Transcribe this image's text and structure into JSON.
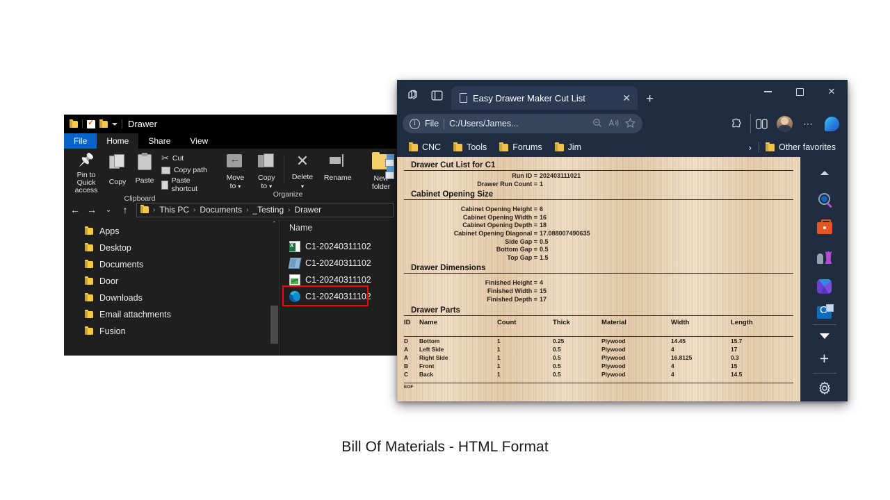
{
  "caption": "Bill Of Materials - HTML Format",
  "explorer": {
    "title": "Drawer",
    "quick_access_icons": [
      "folder-icon",
      "properties-icon",
      "new-folder-icon",
      "customize-chevron-icon"
    ],
    "tabs": [
      {
        "label": "File",
        "active": false,
        "style": "file"
      },
      {
        "label": "Home",
        "active": true,
        "style": "normal"
      },
      {
        "label": "Share",
        "active": false,
        "style": "normal"
      },
      {
        "label": "View",
        "active": false,
        "style": "normal"
      }
    ],
    "ribbon": {
      "clipboard": {
        "group_label": "Clipboard",
        "big_buttons": [
          {
            "label": "Pin to Quick\naccess",
            "line1": "Pin to Quick",
            "line2": "access",
            "icon": "pin-icon"
          },
          {
            "label": "Copy",
            "line1": "Copy",
            "line2": "",
            "icon": "copy-icon"
          },
          {
            "label": "Paste",
            "line1": "Paste",
            "line2": "",
            "icon": "paste-icon"
          }
        ],
        "small_buttons": [
          {
            "label": "Cut",
            "icon": "scissors-icon"
          },
          {
            "label": "Copy path",
            "icon": "copy-path-icon"
          },
          {
            "label": "Paste shortcut",
            "icon": "paste-shortcut-icon"
          }
        ]
      },
      "organize": {
        "group_label": "Organize",
        "big_buttons": [
          {
            "line1": "Move",
            "line2": "to",
            "icon": "move-to-icon",
            "dropdown": true
          },
          {
            "line1": "Copy",
            "line2": "to",
            "icon": "copy-to-icon",
            "dropdown": true
          },
          {
            "line1": "Delete",
            "line2": "",
            "icon": "delete-icon",
            "dropdown": true
          },
          {
            "line1": "Rename",
            "line2": "",
            "icon": "rename-icon",
            "dropdown": false
          }
        ]
      },
      "new": {
        "big_buttons": [
          {
            "line1": "New",
            "line2": "folder",
            "icon": "new-folder-icon"
          }
        ]
      }
    },
    "navigation": {
      "back_icon": "arrow-left-icon",
      "forward_icon": "arrow-right-icon",
      "recent_icon": "chevron-down-icon",
      "up_icon": "arrow-up-icon"
    },
    "breadcrumb": [
      "This PC",
      "Documents",
      "_Testing",
      "Drawer"
    ],
    "nav_pane": [
      {
        "label": "Apps"
      },
      {
        "label": "Desktop"
      },
      {
        "label": "Documents"
      },
      {
        "label": "Door"
      },
      {
        "label": "Downloads"
      },
      {
        "label": "Email attachments"
      },
      {
        "label": "Fusion"
      }
    ],
    "file_list": {
      "column_header": "Name",
      "rows": [
        {
          "name": "C1-20240311102",
          "icon": "excel-file-icon",
          "selected": false
        },
        {
          "name": "C1-20240311102",
          "icon": "3d-model-file-icon",
          "selected": false
        },
        {
          "name": "C1-20240311102",
          "icon": "chart-file-icon",
          "selected": false
        },
        {
          "name": "C1-20240311102",
          "icon": "edge-html-file-icon",
          "selected": true
        }
      ]
    }
  },
  "edge": {
    "tab_strip": {
      "workspaces_icon": "workspaces-icon",
      "tab_actions_icon": "tab-actions-icon",
      "tab": {
        "title": "Easy Drawer Maker Cut List",
        "favicon": "document-icon",
        "close_icon": "close-icon"
      },
      "new_tab_label": "+",
      "window_controls": {
        "minimize": "minimize-icon",
        "maximize": "maximize-icon",
        "close": "close-icon"
      }
    },
    "toolbar": {
      "scheme_label": "File",
      "url": "C:/Users/James...",
      "omnibox_icons": [
        "info-icon",
        "zoom-out-icon",
        "read-aloud-icon",
        "favorite-star-icon"
      ],
      "right_icons": [
        "extensions-icon",
        "split-screen-icon",
        "avatar",
        "more-options-icon",
        "copilot-icon"
      ]
    },
    "bookmarks": [
      {
        "label": "CNC"
      },
      {
        "label": "Tools"
      },
      {
        "label": "Forums"
      },
      {
        "label": "Jim"
      }
    ],
    "bookmarks_overflow_icon": "chevron-right-icon",
    "other_favorites": "Other favorites",
    "sidebar_icons": [
      "collapse-up-icon",
      "search-icon",
      "shopping-icon",
      "games-icon",
      "office-icon",
      "outlook-icon",
      "expand-down-icon",
      "add-app-icon",
      "sidebar-settings-icon"
    ]
  },
  "document": {
    "title": "Drawer Cut List for C1",
    "header_fields": [
      {
        "label": "Run ID",
        "value": "202403111021"
      },
      {
        "label": "Drawer Run Count",
        "value": "1"
      }
    ],
    "cabinet_opening": {
      "heading": "Cabinet Opening Size",
      "fields": [
        {
          "label": "Cabinet Opening Height",
          "value": "6"
        },
        {
          "label": "Cabinet Opening Width",
          "value": "16"
        },
        {
          "label": "Cabinet Opening Depth",
          "value": "18"
        },
        {
          "label": "Cabinet Opening Diagonal",
          "value": "17.088007490635"
        },
        {
          "label": "Side Gap",
          "value": "0.5"
        },
        {
          "label": "Bottom Gap",
          "value": "0.5"
        },
        {
          "label": "Top Gap",
          "value": "1.5"
        }
      ]
    },
    "drawer_dimensions": {
      "heading": "Drawer Dimensions",
      "fields": [
        {
          "label": "Finished Height",
          "value": "4"
        },
        {
          "label": "Finished Width",
          "value": "15"
        },
        {
          "label": "Finished Depth",
          "value": "17"
        }
      ]
    },
    "drawer_parts": {
      "heading": "Drawer Parts",
      "columns": [
        "ID",
        "Name",
        "Count",
        "Thick",
        "Material",
        "Width",
        "Length"
      ],
      "rows": [
        [
          "D",
          "Bottom",
          "1",
          "0.25",
          "Plywood",
          "14.45",
          "15.7"
        ],
        [
          "A",
          "Left Side",
          "1",
          "0.5",
          "Plywood",
          "4",
          "17"
        ],
        [
          "A",
          "Right Side",
          "1",
          "0.5",
          "Plywood",
          "16.8125",
          "0.3"
        ],
        [
          "B",
          "Front",
          "1",
          "0.5",
          "Plywood",
          "4",
          "15"
        ],
        [
          "C",
          "Back",
          "1",
          "0.5",
          "Plywood",
          "4",
          "14.5"
        ]
      ]
    },
    "eof": "EOF"
  },
  "colors": {
    "explorer_bg": "#1f1f1f",
    "explorer_titlebar": "#000000",
    "file_tab_accent": "#0a64c8",
    "edge_chrome": "#202c3f",
    "edge_tab_active": "#2b3a52",
    "selection_outline": "#ff0000",
    "paper": "#e8cfae"
  }
}
